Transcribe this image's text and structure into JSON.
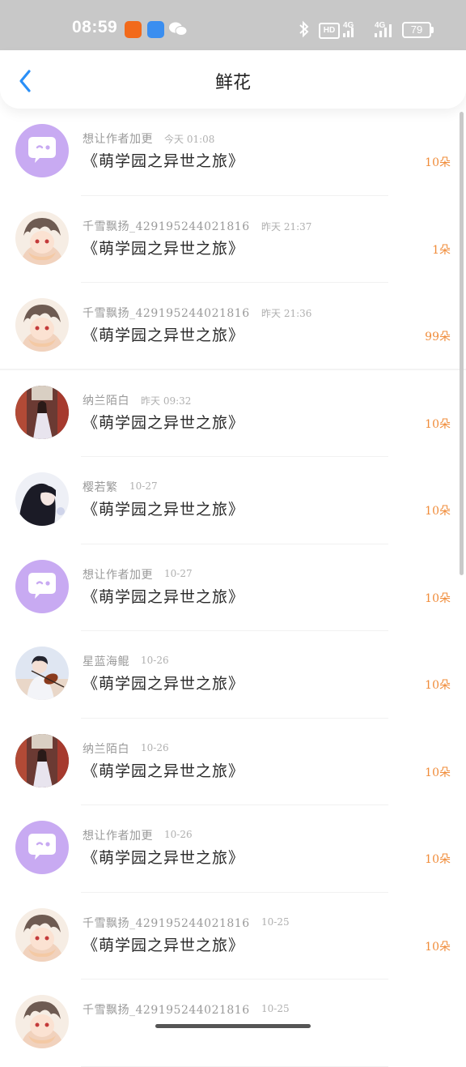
{
  "status": {
    "time": "08:59",
    "hd": "HD",
    "net1": "4G",
    "net2": "4G",
    "battery": "79"
  },
  "header": {
    "title": "鲜花",
    "back_icon": "chevron-left-icon"
  },
  "colors": {
    "accent": "#2a8ff7",
    "count": "#f08c3a",
    "purple": "#c5a8f0"
  },
  "rows": [
    {
      "user": "想让作者加更",
      "time": "今天 01:08",
      "book": "《萌学园之异世之旅》",
      "count": "10朵",
      "avatar": "purple"
    },
    {
      "user": "千雪飘扬_429195244021816",
      "time": "昨天 21:37",
      "book": "《萌学园之异世之旅》",
      "count": "1朵",
      "avatar": "anime-boy"
    },
    {
      "user": "千雪飘扬_429195244021816",
      "time": "昨天 21:36",
      "book": "《萌学园之异世之旅》",
      "count": "99朵",
      "avatar": "anime-boy"
    },
    {
      "user": "纳兰陌白",
      "time": "昨天 09:32",
      "book": "《萌学园之异世之旅》",
      "count": "10朵",
      "avatar": "girl-red"
    },
    {
      "user": "樱若繁",
      "time": "10-27",
      "book": "《萌学园之异世之旅》",
      "count": "10朵",
      "avatar": "girl-dark"
    },
    {
      "user": "想让作者加更",
      "time": "10-27",
      "book": "《萌学园之异世之旅》",
      "count": "10朵",
      "avatar": "purple"
    },
    {
      "user": "星蓝海鲲",
      "time": "10-26",
      "book": "《萌学园之异世之旅》",
      "count": "10朵",
      "avatar": "violin"
    },
    {
      "user": "纳兰陌白",
      "time": "10-26",
      "book": "《萌学园之异世之旅》",
      "count": "10朵",
      "avatar": "girl-red"
    },
    {
      "user": "想让作者加更",
      "time": "10-26",
      "book": "《萌学园之异世之旅》",
      "count": "10朵",
      "avatar": "purple"
    },
    {
      "user": "千雪飘扬_429195244021816",
      "time": "10-25",
      "book": "《萌学园之异世之旅》",
      "count": "10朵",
      "avatar": "anime-boy"
    },
    {
      "user": "千雪飘扬_429195244021816",
      "time": "10-25",
      "book": "",
      "count": "",
      "avatar": "anime-boy"
    }
  ]
}
